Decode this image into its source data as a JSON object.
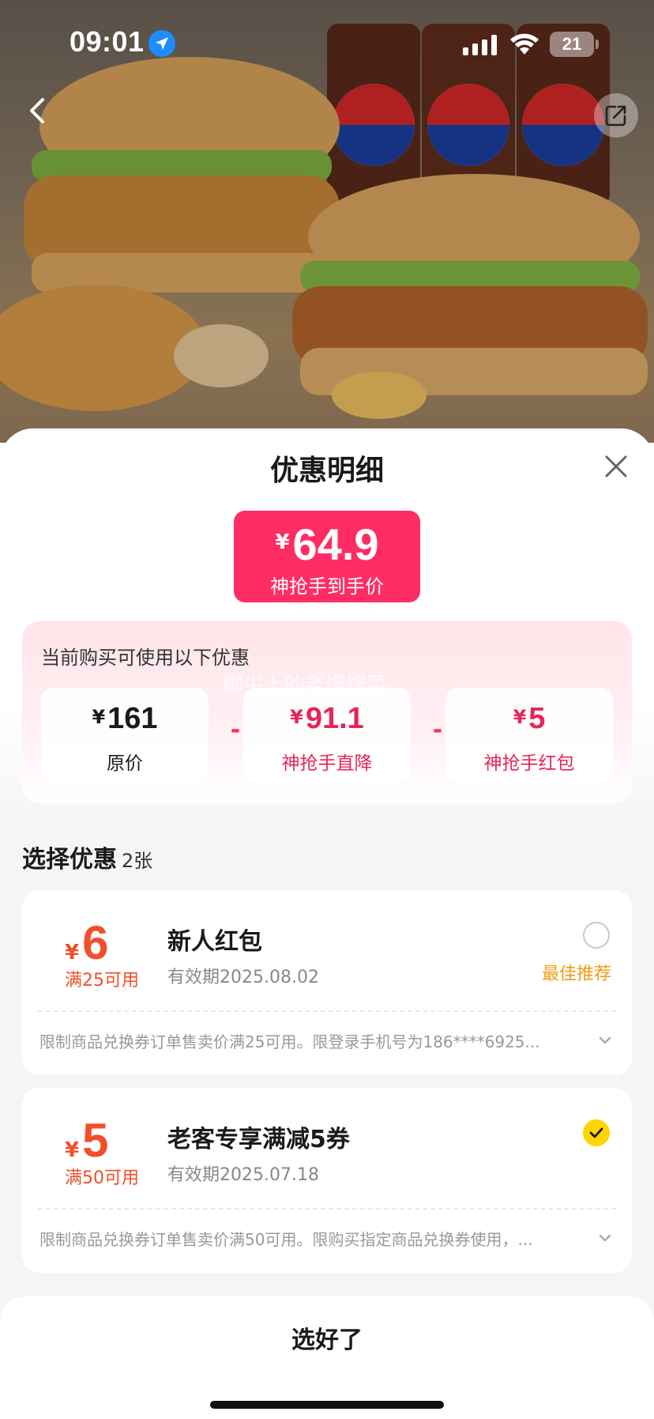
{
  "status_bar": {
    "time": "09:01",
    "battery": "21"
  },
  "sheet": {
    "title": "优惠明细",
    "final_price": {
      "currency": "¥",
      "value": "64.9",
      "label": "神抢手到手价"
    },
    "breakdown": {
      "caption": "当前购买可使用以下优惠",
      "watermark": "脚尖上的老馒馒菜",
      "items": [
        {
          "currency": "¥",
          "value": "161",
          "label": "原价"
        },
        {
          "currency": "¥",
          "value": "91.1",
          "label": "神抢手直降"
        },
        {
          "currency": "¥",
          "value": "5",
          "label": "神抢手红包"
        }
      ],
      "operator": "-"
    },
    "section": {
      "title": "选择优惠",
      "count": "2张"
    },
    "coupons": [
      {
        "currency": "¥",
        "amount": "6",
        "condition": "满25可用",
        "name": "新人红包",
        "expiry": "有效期2025.08.02",
        "tag": "最佳推荐",
        "selected": false,
        "rule": "限制商品兑换券订单售卖价满25可用。限登录手机号为186****6925..."
      },
      {
        "currency": "¥",
        "amount": "5",
        "condition": "满50可用",
        "name": "老客专享满减5券",
        "expiry": "有效期2025.07.18",
        "tag": "",
        "selected": true,
        "rule": "限制商品兑换券订单售卖价满50可用。限购买指定商品兑换券使用，..."
      }
    ],
    "confirm_label": "选好了"
  },
  "colors": {
    "accent": "#ff2d63",
    "coupon": "#f04f2a",
    "check": "#ffd400",
    "tag": "#f39c12"
  }
}
